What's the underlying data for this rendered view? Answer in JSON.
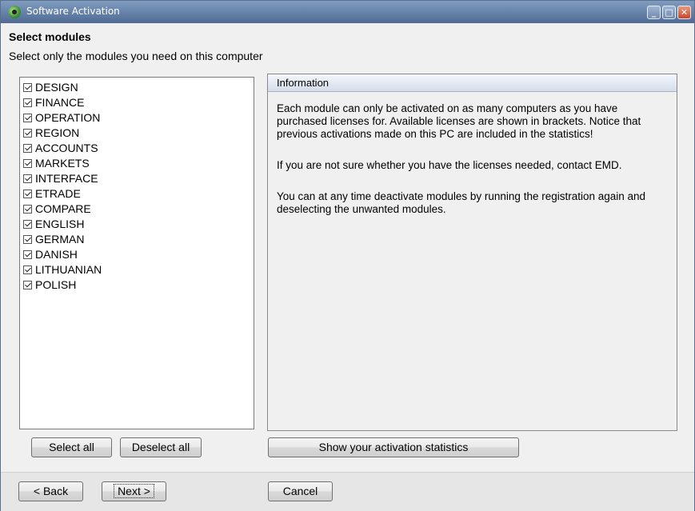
{
  "window": {
    "title": "Software Activation"
  },
  "titlebar_buttons": {
    "minimize": "_",
    "maximize": "□",
    "close": "✕"
  },
  "page": {
    "heading": "Select modules",
    "subheading": "Select only the modules you need on this computer"
  },
  "modules": [
    {
      "label": "DESIGN",
      "checked": true
    },
    {
      "label": "FINANCE",
      "checked": true
    },
    {
      "label": "OPERATION",
      "checked": true
    },
    {
      "label": "REGION",
      "checked": true
    },
    {
      "label": "ACCOUNTS",
      "checked": true
    },
    {
      "label": "MARKETS",
      "checked": true
    },
    {
      "label": "INTERFACE",
      "checked": true
    },
    {
      "label": "ETRADE",
      "checked": true
    },
    {
      "label": "COMPARE",
      "checked": true
    },
    {
      "label": "ENGLISH",
      "checked": true
    },
    {
      "label": "GERMAN",
      "checked": true
    },
    {
      "label": "DANISH",
      "checked": true
    },
    {
      "label": "LITHUANIAN",
      "checked": true
    },
    {
      "label": "POLISH",
      "checked": true
    }
  ],
  "info": {
    "header": "Information",
    "paragraphs": [
      "Each module can only be activated on as many computers as you have purchased licenses for.  Available licenses are shown in brackets. Notice that previous activations made on this PC are included in the statistics!",
      "If you are not sure whether you have the licenses needed, contact EMD.",
      "You can at any time deactivate modules by running the registration again and deselecting the unwanted modules."
    ]
  },
  "buttons": {
    "select_all": "Select all",
    "deselect_all": "Deselect all",
    "show_stats": "Show your activation statistics",
    "back": "< Back",
    "next": "Next >",
    "cancel": "Cancel"
  },
  "icons": {
    "app": "app-logo-icon"
  }
}
